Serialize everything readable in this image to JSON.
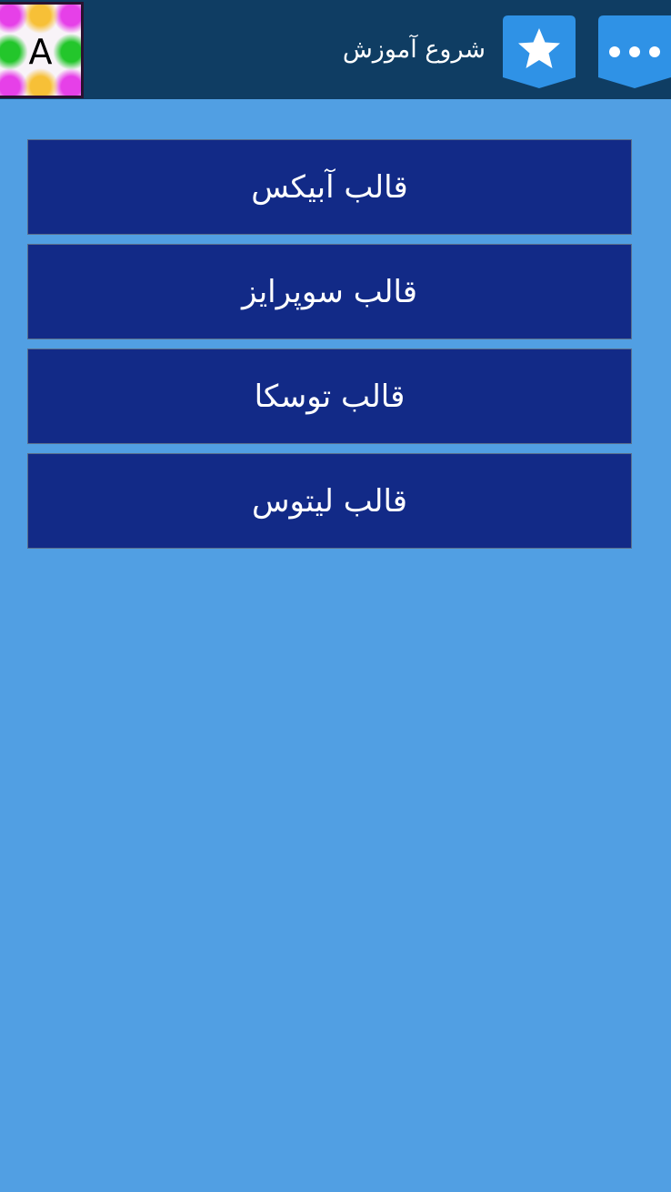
{
  "app": {
    "logo_letter": "A"
  },
  "header": {
    "title": "شروع آموزش",
    "favorite_icon": "star-icon",
    "menu_icon": "more-dots-icon"
  },
  "colors": {
    "background": "#519fe3",
    "topbar": "#0f3d63",
    "item": "#122a87",
    "header_button": "#2f92e6"
  },
  "templates": {
    "items": [
      {
        "label": "قالب آبیکس"
      },
      {
        "label": "قالب سوپرایز"
      },
      {
        "label": "قالب توسکا"
      },
      {
        "label": "قالب لیتوس"
      }
    ]
  }
}
